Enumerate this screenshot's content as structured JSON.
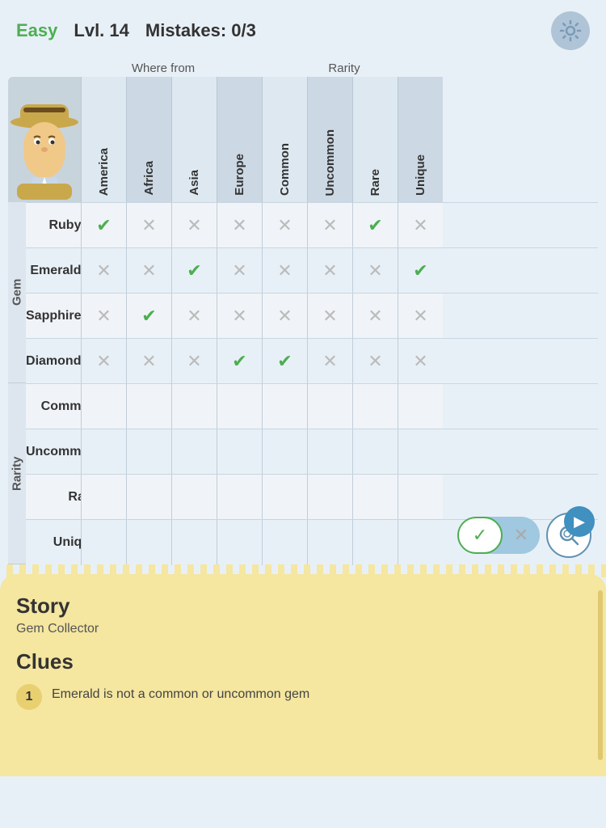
{
  "header": {
    "difficulty": "Easy",
    "level": "Lvl. 14",
    "mistakes_label": "Mistakes:",
    "mistakes_value": "0/3"
  },
  "categories": {
    "where_from": "Where from",
    "rarity": "Rarity"
  },
  "columns": [
    {
      "id": "america",
      "label": "America",
      "group": "where_from"
    },
    {
      "id": "africa",
      "label": "Africa",
      "group": "where_from"
    },
    {
      "id": "asia",
      "label": "Asia",
      "group": "where_from"
    },
    {
      "id": "europe",
      "label": "Europe",
      "group": "where_from"
    },
    {
      "id": "common",
      "label": "Common",
      "group": "rarity"
    },
    {
      "id": "uncommon",
      "label": "Uncommon",
      "group": "rarity"
    },
    {
      "id": "rare",
      "label": "Rare",
      "group": "rarity"
    },
    {
      "id": "unique",
      "label": "Unique",
      "group": "rarity"
    }
  ],
  "rows": [
    {
      "group": "Gem",
      "items": [
        {
          "label": "Ruby",
          "cells": [
            "check",
            "cross",
            "cross",
            "cross",
            "cross",
            "cross",
            "check",
            "cross"
          ]
        },
        {
          "label": "Emerald",
          "cells": [
            "cross",
            "cross",
            "check",
            "cross",
            "cross",
            "cross",
            "cross",
            "check"
          ]
        },
        {
          "label": "Sapphire",
          "cells": [
            "cross",
            "check",
            "cross",
            "cross",
            "cross",
            "cross",
            "cross",
            "cross"
          ]
        },
        {
          "label": "Diamond",
          "cells": [
            "cross",
            "cross",
            "cross",
            "check",
            "check",
            "cross",
            "cross",
            "cross"
          ]
        }
      ]
    },
    {
      "group": "Rarity",
      "items": [
        {
          "label": "Common",
          "cells": [
            "",
            "",
            "",
            "",
            "",
            "",
            "",
            ""
          ]
        },
        {
          "label": "Uncommon",
          "cells": [
            "",
            "",
            "",
            "",
            "",
            "",
            "",
            ""
          ]
        },
        {
          "label": "Rare",
          "cells": [
            "",
            "",
            "",
            "",
            "",
            "",
            "",
            ""
          ]
        },
        {
          "label": "Unique",
          "cells": [
            "",
            "",
            "",
            "",
            "",
            "",
            "",
            ""
          ]
        }
      ]
    }
  ],
  "story": {
    "section_label": "Story",
    "subtitle": "Gem Collector",
    "clues_label": "Clues",
    "clues": [
      {
        "num": "1",
        "text": "Emerald is not a common or uncommon gem"
      }
    ]
  },
  "buttons": {
    "confirm_check": "✓",
    "confirm_x": "✕",
    "search": "🔍",
    "play": "▶"
  }
}
